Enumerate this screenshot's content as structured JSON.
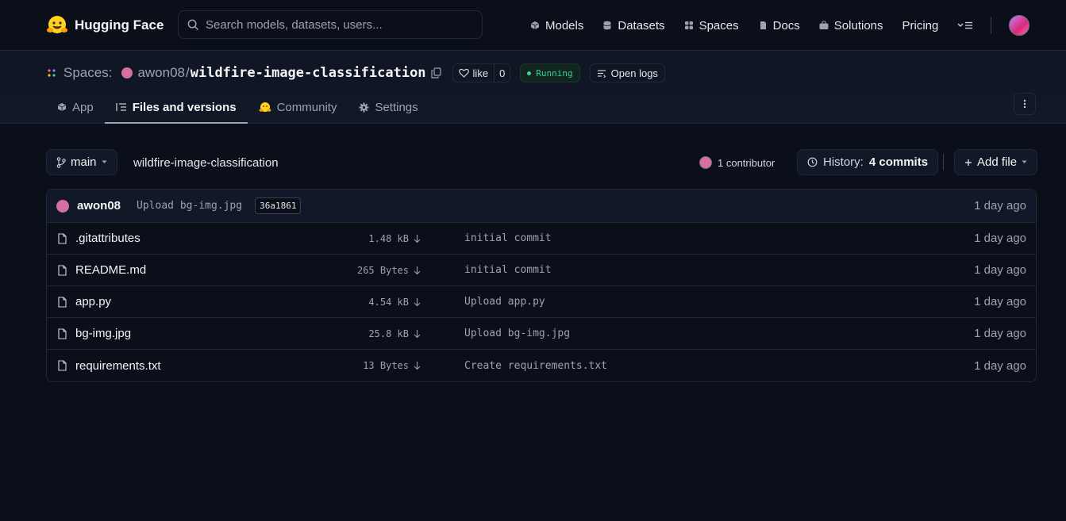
{
  "app": {
    "brand": "Hugging Face"
  },
  "search": {
    "placeholder": "Search models, datasets, users..."
  },
  "nav": {
    "items": [
      {
        "label": "Models",
        "icon": "models-icon"
      },
      {
        "label": "Datasets",
        "icon": "datasets-icon"
      },
      {
        "label": "Spaces",
        "icon": "spaces-icon"
      },
      {
        "label": "Docs",
        "icon": "docs-icon"
      },
      {
        "label": "Solutions",
        "icon": "solutions-icon"
      }
    ],
    "pricing": "Pricing"
  },
  "repo": {
    "section": "Spaces:",
    "owner": "awon08",
    "name": "wildfire-image-classification",
    "like_label": "like",
    "like_count": "0",
    "status": "Running",
    "logs_label": "Open logs"
  },
  "tabs": [
    {
      "label": "App",
      "icon": "cube-icon",
      "active": false
    },
    {
      "label": "Files and versions",
      "icon": "files-icon",
      "active": true
    },
    {
      "label": "Community",
      "icon": "hug-icon",
      "active": false
    },
    {
      "label": "Settings",
      "icon": "gear-icon",
      "active": false
    }
  ],
  "branch": {
    "name": "main",
    "path": "wildfire-image-classification",
    "contributors": "1 contributor",
    "history_prefix": "History:",
    "history_count": "4 commits",
    "add_file": "Add file"
  },
  "last_commit": {
    "author": "awon08",
    "message": "Upload bg-img.jpg",
    "sha": "36a1861",
    "time": "1 day ago"
  },
  "files": [
    {
      "name": ".gitattributes",
      "size": "1.48 kB",
      "message": "initial commit",
      "time": "1 day ago"
    },
    {
      "name": "README.md",
      "size": "265 Bytes",
      "message": "initial commit",
      "time": "1 day ago"
    },
    {
      "name": "app.py",
      "size": "4.54 kB",
      "message": "Upload app.py",
      "time": "1 day ago"
    },
    {
      "name": "bg-img.jpg",
      "size": "25.8 kB",
      "message": "Upload bg-img.jpg",
      "time": "1 day ago"
    },
    {
      "name": "requirements.txt",
      "size": "13 Bytes",
      "message": "Create requirements.txt",
      "time": "1 day ago"
    }
  ],
  "colors": {
    "background": "#0b0f19",
    "accent_running": "#34d399",
    "border": "#1f2937"
  }
}
